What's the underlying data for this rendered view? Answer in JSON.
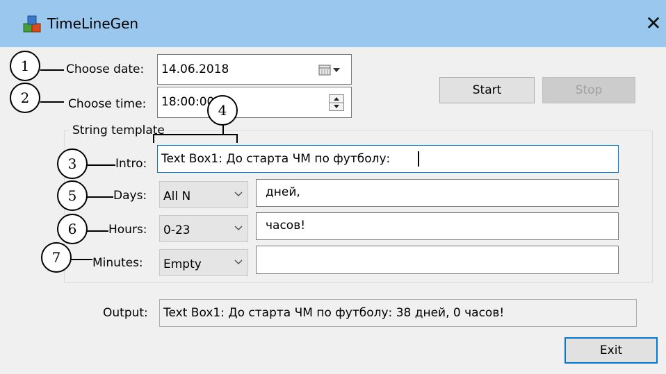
{
  "window": {
    "title": "TimeLineGen",
    "close_glyph": "✕"
  },
  "date": {
    "label": "Choose date:",
    "value": "14.06.2018"
  },
  "time": {
    "label": "Choose time:",
    "value": "18:00:00"
  },
  "buttons": {
    "start": "Start",
    "stop": "Stop",
    "exit": "Exit"
  },
  "template": {
    "group_label": "String template",
    "intro": {
      "label": "Intro:",
      "value": "Text Box1: До старта ЧМ по футболу: "
    },
    "days": {
      "label": "Days:",
      "format": "All N",
      "suffix": "дней,"
    },
    "hours": {
      "label": "Hours:",
      "format": "0-23",
      "suffix": "часов!"
    },
    "minutes": {
      "label": "Minutes:",
      "format": "Empty",
      "suffix": ""
    }
  },
  "output": {
    "label": "Output:",
    "value": "Text Box1: До старта ЧМ по футболу: 38 дней, 0 часов!"
  },
  "callouts": [
    "1",
    "2",
    "3",
    "4",
    "5",
    "6",
    "7"
  ],
  "icons": {
    "app": "app-cubes-icon",
    "calendar": "calendar-dropdown-icon",
    "spinner": "spin-updown-icon",
    "chevron": "chevron-down-icon"
  }
}
